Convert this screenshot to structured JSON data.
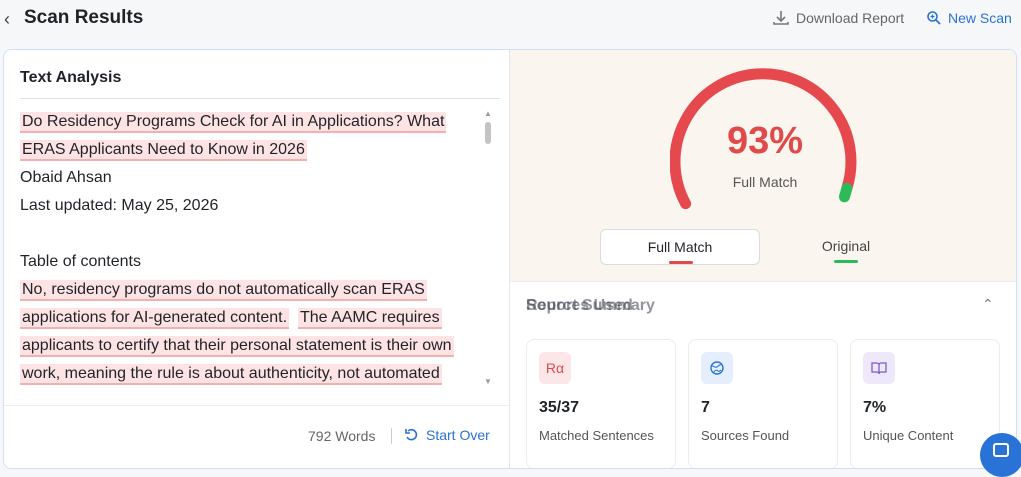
{
  "header": {
    "back_icon": "chevron-left-icon",
    "title": "Scan Results",
    "download_label": "Download Report",
    "new_scan_label": "New Scan"
  },
  "analysis": {
    "title": "Text Analysis",
    "lines": {
      "l1": "Do Residency Programs Check for AI in Applications? What",
      "l2": "ERAS Applicants Need to Know in 2026",
      "l3": "Obaid Ahsan",
      "l4": "Last updated: May 25, 2026",
      "l5": "Table of contents",
      "l6": "No, residency programs do not automatically scan ERAS",
      "l7a": "applications for AI-generated content.",
      "l7b": "The AAMC requires",
      "l8": "applicants to certify that their personal statement is their own",
      "l9": "work, meaning the rule is about authenticity, not automated"
    },
    "word_count": "792 Words",
    "start_over_label": "Start Over"
  },
  "score": {
    "percent": "93%",
    "label": "Full Match",
    "value": 93,
    "tabs": {
      "full_match": "Full Match",
      "original": "Original"
    }
  },
  "summary": {
    "title": "Report Summary",
    "overlap_title": "Sources Used",
    "stats": [
      {
        "value": "35/37",
        "label": "Matched Sentences",
        "icon": "text-compare-icon"
      },
      {
        "value": "7",
        "label": "Sources Found",
        "icon": "globe-icon"
      },
      {
        "value": "7%",
        "label": "Unique Content",
        "icon": "book-icon"
      }
    ]
  },
  "colors": {
    "accent": "#2a73d6",
    "match_red": "#e04a4a",
    "original_green": "#2dbb5a",
    "highlight": "#fde3e3"
  }
}
